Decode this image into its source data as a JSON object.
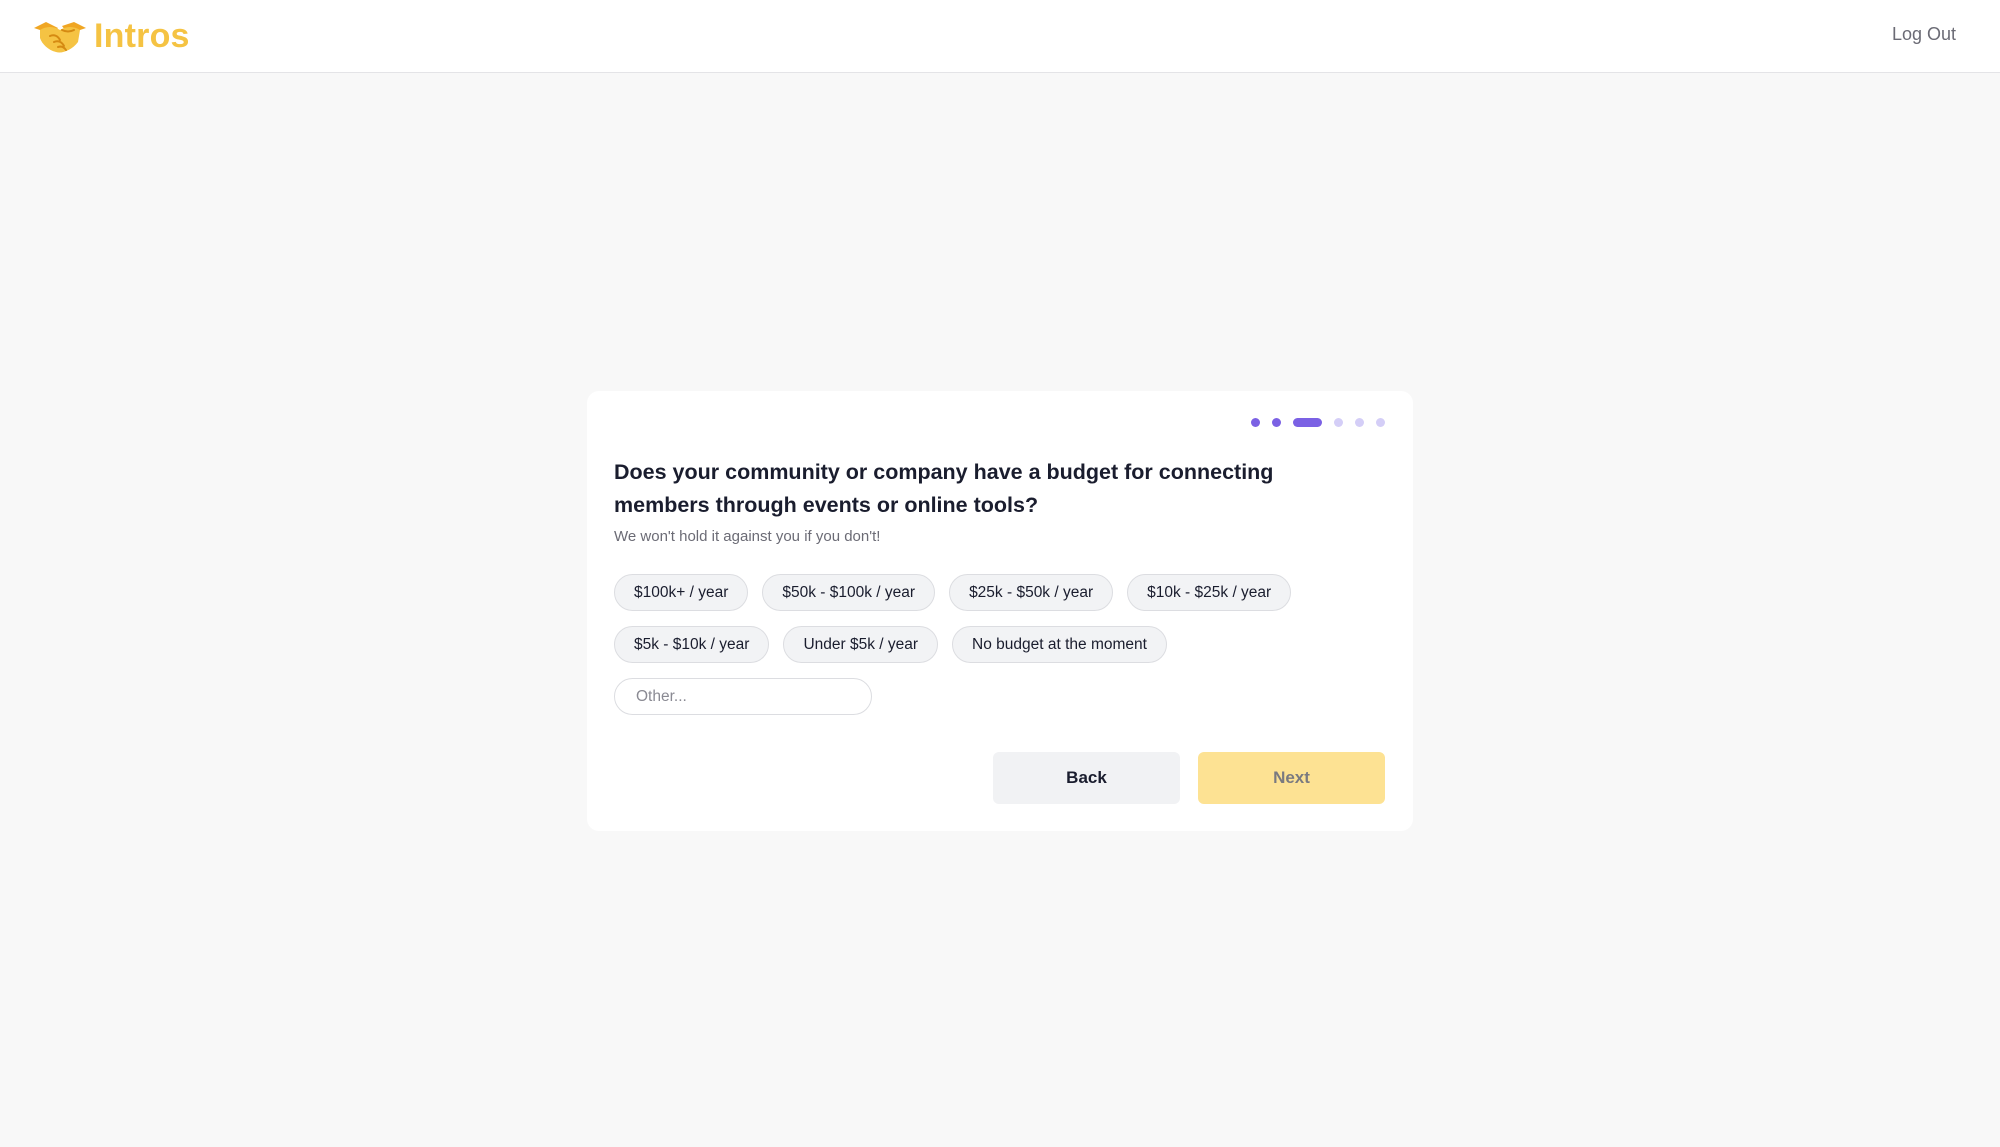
{
  "header": {
    "brand_name": "Intros",
    "brand_icon": "handshake-icon",
    "brand_color": "#f5c343",
    "logout_label": "Log Out"
  },
  "stepper": {
    "total_steps": 6,
    "current_step": 3,
    "accent_color": "#7b61e4"
  },
  "question": {
    "title": "Does your community or company have a budget for connecting members through events or online tools?",
    "subtitle": "We won't hold it against you if you don't!"
  },
  "options": [
    "$100k+ / year",
    "$50k - $100k / year",
    "$25k - $50k / year",
    "$10k - $25k / year",
    "$5k - $10k / year",
    "Under $5k / year",
    "No budget at the moment"
  ],
  "other_input": {
    "placeholder": "Other...",
    "value": ""
  },
  "actions": {
    "back_label": "Back",
    "next_label": "Next",
    "next_color": "#fde293"
  }
}
